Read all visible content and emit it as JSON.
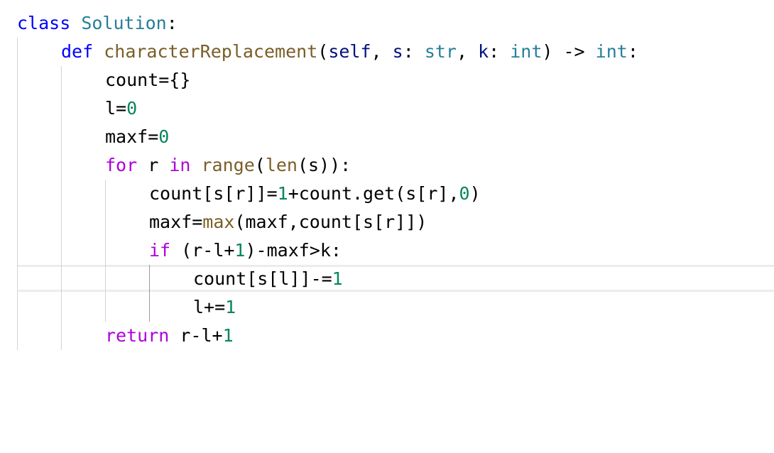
{
  "editor": {
    "colors": {
      "keyword": "#0000ff",
      "control": "#af00db",
      "type": "#267f99",
      "function": "#795e26",
      "parameter": "#001080",
      "number": "#098658",
      "text": "#000000",
      "current_line_border": "#ececec",
      "indent_guide": "#d3d3d3"
    },
    "lines": [
      {
        "tokens": [
          {
            "t": "class",
            "c": "kw"
          },
          {
            "t": " ",
            "c": "plain"
          },
          {
            "t": "Solution",
            "c": "cls"
          },
          {
            "t": ":",
            "c": "plain"
          }
        ]
      },
      {
        "tokens": [
          {
            "t": "def",
            "c": "kw"
          },
          {
            "t": " ",
            "c": "plain"
          },
          {
            "t": "characterReplacement",
            "c": "fn"
          },
          {
            "t": "(",
            "c": "plain"
          },
          {
            "t": "self",
            "c": "param"
          },
          {
            "t": ", ",
            "c": "plain"
          },
          {
            "t": "s",
            "c": "param"
          },
          {
            "t": ": ",
            "c": "plain"
          },
          {
            "t": "str",
            "c": "cls"
          },
          {
            "t": ", ",
            "c": "plain"
          },
          {
            "t": "k",
            "c": "param"
          },
          {
            "t": ": ",
            "c": "plain"
          },
          {
            "t": "int",
            "c": "cls"
          },
          {
            "t": ") -> ",
            "c": "plain"
          },
          {
            "t": "int",
            "c": "cls"
          },
          {
            "t": ":",
            "c": "plain"
          }
        ]
      },
      {
        "tokens": [
          {
            "t": "count={}",
            "c": "plain"
          }
        ]
      },
      {
        "tokens": [
          {
            "t": "l=",
            "c": "plain"
          },
          {
            "t": "0",
            "c": "num"
          }
        ]
      },
      {
        "tokens": [
          {
            "t": "maxf=",
            "c": "plain"
          },
          {
            "t": "0",
            "c": "num"
          }
        ]
      },
      {
        "tokens": [
          {
            "t": "for",
            "c": "ctl"
          },
          {
            "t": " r ",
            "c": "plain"
          },
          {
            "t": "in",
            "c": "ctl"
          },
          {
            "t": " ",
            "c": "plain"
          },
          {
            "t": "range",
            "c": "fn"
          },
          {
            "t": "(",
            "c": "plain"
          },
          {
            "t": "len",
            "c": "fn"
          },
          {
            "t": "(s)):",
            "c": "plain"
          }
        ]
      },
      {
        "tokens": [
          {
            "t": "count[s[r]]=",
            "c": "plain"
          },
          {
            "t": "1",
            "c": "num"
          },
          {
            "t": "+count.get(s[r],",
            "c": "plain"
          },
          {
            "t": "0",
            "c": "num"
          },
          {
            "t": ")",
            "c": "plain"
          }
        ]
      },
      {
        "tokens": [
          {
            "t": "maxf=",
            "c": "plain"
          },
          {
            "t": "max",
            "c": "fn"
          },
          {
            "t": "(maxf,count[s[r]])",
            "c": "plain"
          }
        ]
      },
      {
        "tokens": [
          {
            "t": "if",
            "c": "ctl"
          },
          {
            "t": " (r-l+",
            "c": "plain"
          },
          {
            "t": "1",
            "c": "num"
          },
          {
            "t": ")-maxf>k:",
            "c": "plain"
          }
        ]
      },
      {
        "tokens": [
          {
            "t": "count[s[l]]-=",
            "c": "plain"
          },
          {
            "t": "1",
            "c": "num"
          }
        ]
      },
      {
        "tokens": [
          {
            "t": "l+=",
            "c": "plain"
          },
          {
            "t": "1",
            "c": "num"
          }
        ]
      },
      {
        "tokens": [
          {
            "t": "return",
            "c": "ctl"
          },
          {
            "t": " r-l+",
            "c": "plain"
          },
          {
            "t": "1",
            "c": "num"
          }
        ]
      }
    ]
  }
}
